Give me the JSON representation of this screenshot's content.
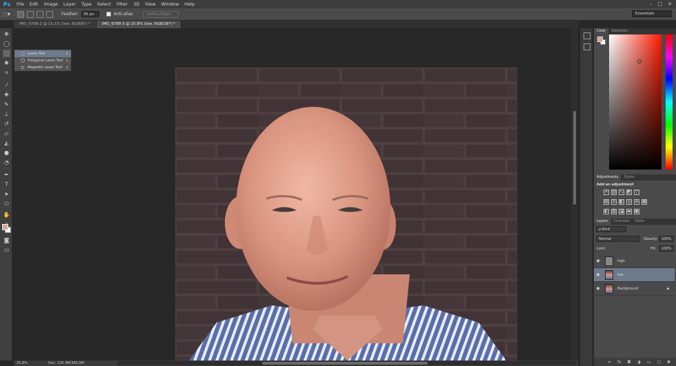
{
  "menubar": {
    "logo": "Ps",
    "items": [
      "File",
      "Edit",
      "Image",
      "Layer",
      "Type",
      "Select",
      "Filter",
      "3D",
      "View",
      "Window",
      "Help"
    ],
    "controls": [
      "–",
      "□",
      "✕"
    ]
  },
  "options": {
    "feather_label": "Feather:",
    "feather_value": "36 px",
    "antialias_label": "Anti-alias",
    "refine_label": "Refine Edge...",
    "workspace": "Essentials"
  },
  "tabs": [
    {
      "label": "IMG_9788-2 @ 15.1% (low, RGB/8*) *",
      "active": false
    },
    {
      "label": "IMG_9788-3 @ 25.8% (low, RGB/16*) *",
      "active": true
    }
  ],
  "flyout": {
    "items": [
      {
        "label": "Lasso Tool",
        "key": "L",
        "icon": "lasso-icon"
      },
      {
        "label": "Polygonal Lasso Tool",
        "key": "L",
        "icon": "polygonal-lasso-icon"
      },
      {
        "label": "Magnetic Lasso Tool",
        "key": "L",
        "icon": "magnetic-lasso-icon"
      }
    ]
  },
  "status": {
    "zoom": "25.8%",
    "doc": "Doc: 120.3M/360.9M"
  },
  "colors": {
    "foreground": "#d8a294",
    "background": "#ffffff",
    "accent": "#6d7a8c"
  },
  "color_panel": {
    "tabs": [
      "Color",
      "Swatches"
    ]
  },
  "adjustments": {
    "tabs": [
      "Adjustments",
      "Styles"
    ],
    "title": "Add an adjustment"
  },
  "layers": {
    "tabs": [
      "Layers",
      "Channels",
      "Paths"
    ],
    "kind": "ρ Kind",
    "blend_mode": "Normal",
    "opacity_label": "Opacity:",
    "opacity_value": "100%",
    "lock_label": "Lock:",
    "fill_label": "Fill:",
    "fill_value": "100%",
    "rows": [
      {
        "name": "high",
        "selected": false,
        "locked": false
      },
      {
        "name": "low",
        "selected": true,
        "locked": false
      },
      {
        "name": "Background",
        "selected": false,
        "locked": true
      }
    ]
  }
}
